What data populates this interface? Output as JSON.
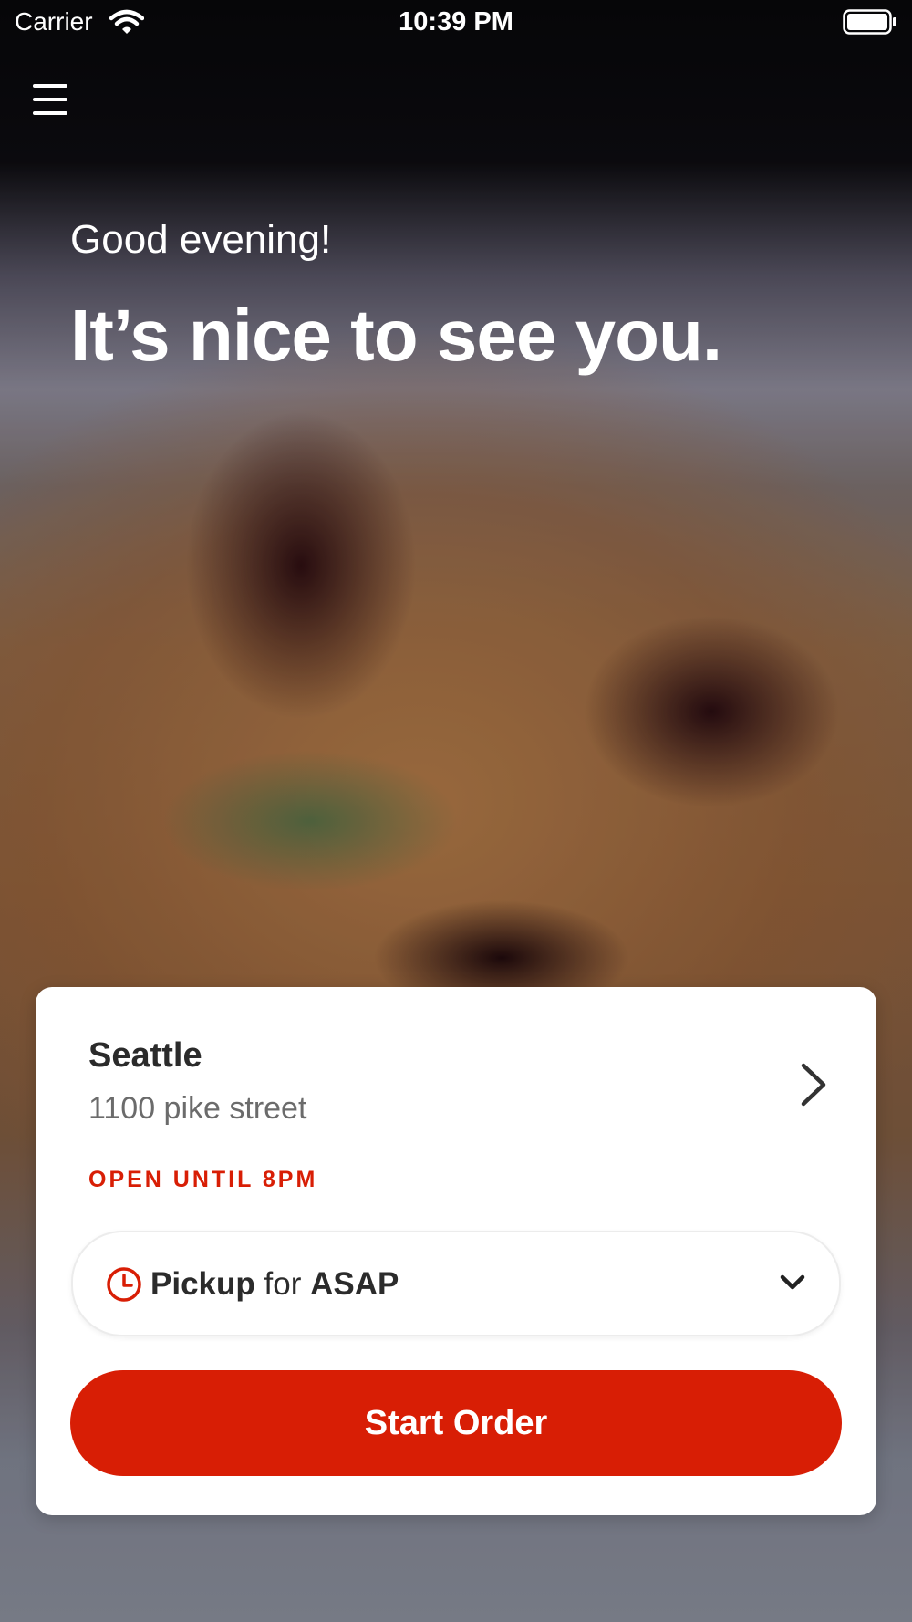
{
  "status_bar": {
    "carrier": "Carrier",
    "time": "10:39 PM",
    "icons": [
      "wifi-icon",
      "battery-icon"
    ]
  },
  "nav": {
    "menu_icon": "hamburger-menu-icon"
  },
  "hero": {
    "greeting": "Good evening!",
    "headline": "It’s nice to see you."
  },
  "location_card": {
    "name": "Seattle",
    "address": "1100 pike street",
    "status": "OPEN UNTIL 8PM",
    "status_color": "#d81e05",
    "order_mode": {
      "method": "Pickup",
      "connector": "for",
      "time": "ASAP",
      "icons": [
        "clock-icon",
        "chevron-down-icon"
      ]
    },
    "cta": {
      "label": "Start Order",
      "color": "#d81e05"
    }
  }
}
